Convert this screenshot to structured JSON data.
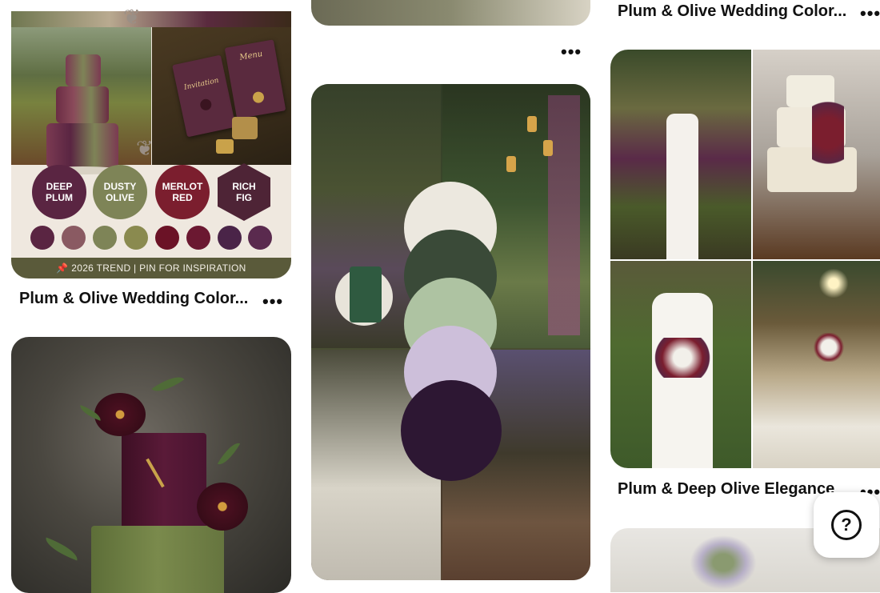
{
  "col1": {
    "pin1": {
      "title": "Plum & Olive Wedding Color...",
      "swatches": [
        {
          "label_line1": "DEEP",
          "label_line2": "PLUM",
          "color": "#5a2542"
        },
        {
          "label_line1": "DUSTY",
          "label_line2": "OLIVE",
          "color": "#7e8457"
        },
        {
          "label_line1": "MERLOT",
          "label_line2": "RED",
          "color": "#7b1e2e"
        },
        {
          "label_line1": "RICH",
          "label_line2": "FIG",
          "color": "#4e2436"
        }
      ],
      "small_swatches": [
        "#5a2542",
        "#8a5a62",
        "#7e8457",
        "#8a8a4f",
        "#6b1226",
        "#6b1831",
        "#4a2448",
        "#5a2a4e"
      ],
      "banner": "📌 2026 TREND | PIN FOR INSPIRATION",
      "menu_title": "Menu",
      "invitation_title": "Invitation"
    }
  },
  "col2": {
    "palette": [
      "#ece8df",
      "#3a4a38",
      "#aec3a2",
      "#cdbfda",
      "#2d1733"
    ]
  },
  "col3": {
    "top_title": "Plum & Olive Wedding Color...",
    "pin5": {
      "title": "Plum & Deep Olive Elegance"
    }
  },
  "more_symbol": "•••",
  "help_symbol": "?"
}
